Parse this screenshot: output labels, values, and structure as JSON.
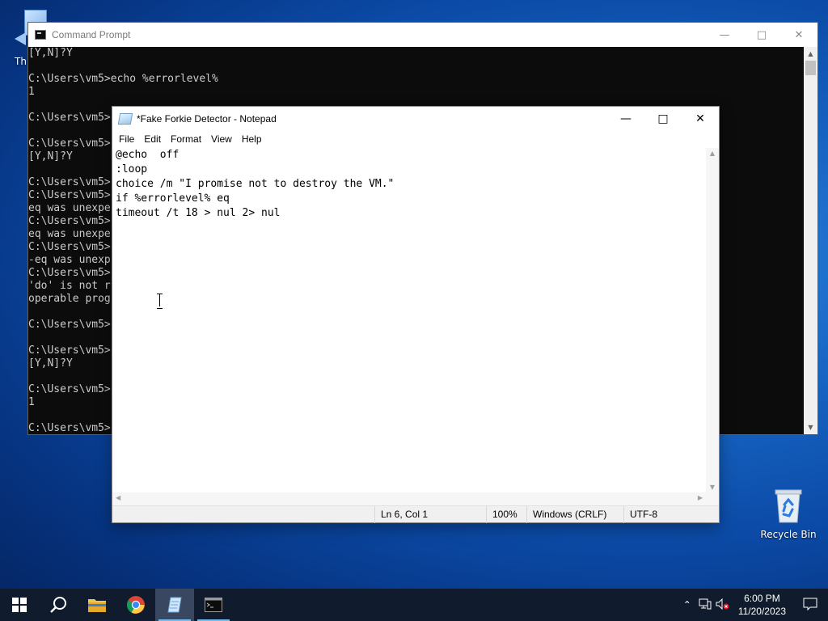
{
  "desktop": {
    "partial_icon_label": "Th",
    "recycle_bin_label": "Recycle Bin"
  },
  "cmd": {
    "title": "Command Prompt",
    "lines": [
      "[Y,N]?Y",
      "",
      "C:\\Users\\vm5>echo %errorlevel%",
      "1",
      "",
      "C:\\Users\\vm5>",
      "",
      "C:\\Users\\vm5>",
      "[Y,N]?Y",
      "",
      "C:\\Users\\vm5>",
      "C:\\Users\\vm5>",
      "eq was unexpe",
      "C:\\Users\\vm5>",
      "eq was unexpe",
      "C:\\Users\\vm5>",
      "-eq was unexp",
      "C:\\Users\\vm5>",
      "'do' is not r",
      "operable prog",
      "",
      "C:\\Users\\vm5>",
      "",
      "C:\\Users\\vm5>",
      "[Y,N]?Y",
      "",
      "C:\\Users\\vm5>",
      "1",
      "",
      "C:\\Users\\vm5>"
    ]
  },
  "notepad": {
    "title": "*Fake Forkie Detector - Notepad",
    "menu": [
      "File",
      "Edit",
      "Format",
      "View",
      "Help"
    ],
    "text": "@echo  off\n:loop\nchoice /m \"I promise not to destroy the VM.\"\nif %errorlevel% eq\ntimeout /t 18 > nul 2> nul",
    "status": {
      "position": "Ln 6, Col 1",
      "zoom": "100%",
      "line_ending": "Windows (CRLF)",
      "encoding": "UTF-8"
    }
  },
  "taskbar": {
    "apps": [
      "start",
      "search",
      "file-explorer",
      "chrome",
      "notepad",
      "command-prompt"
    ],
    "time": "6:00 PM",
    "date": "11/20/2023"
  }
}
